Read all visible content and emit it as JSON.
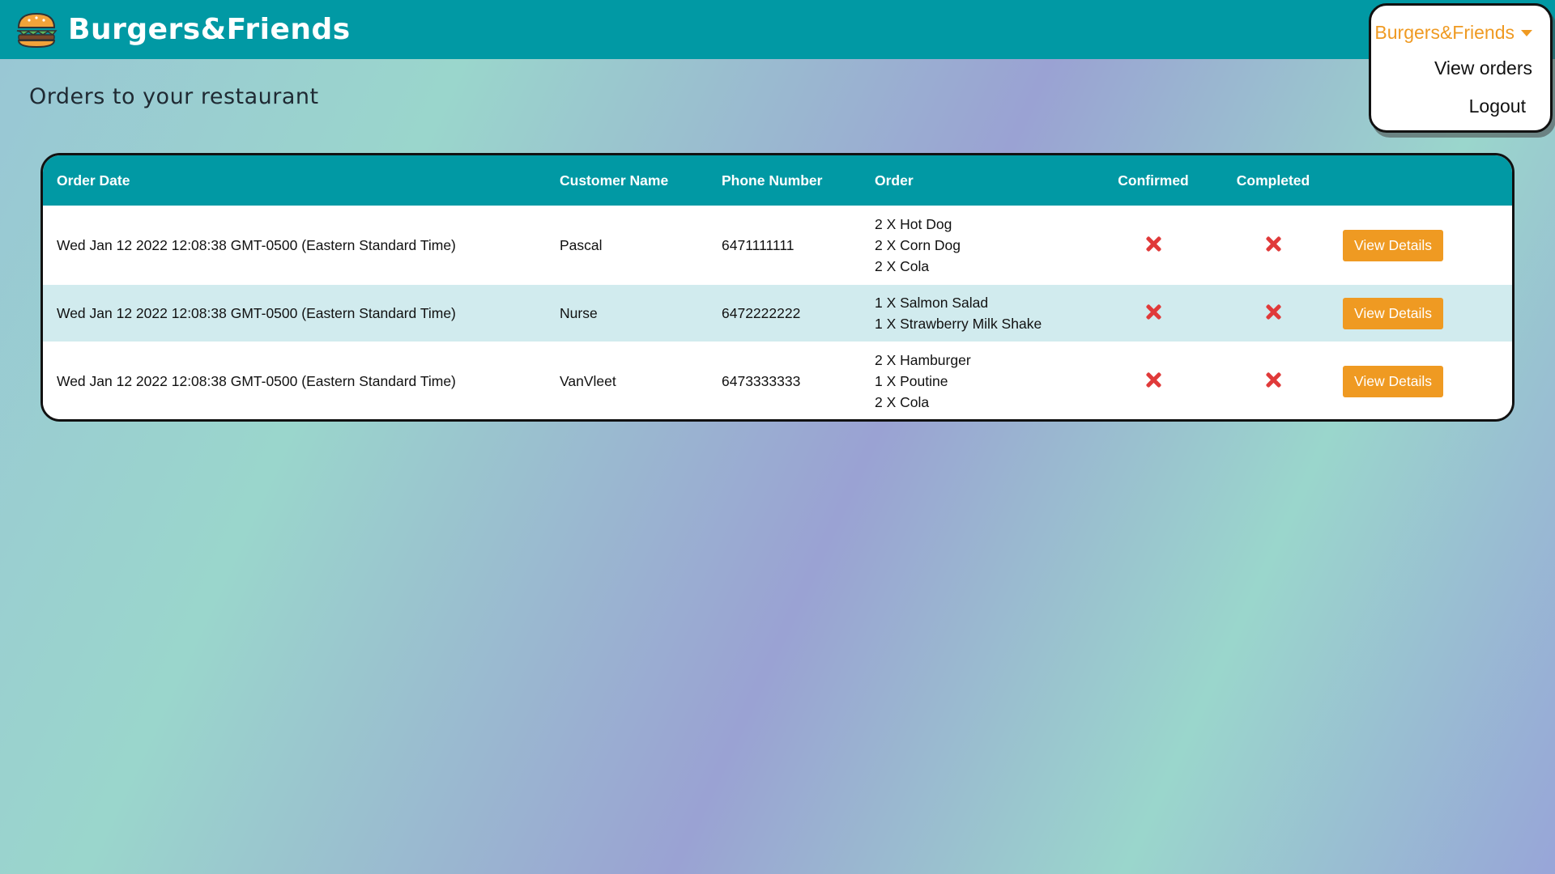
{
  "app": {
    "brand": "Burgers&Friends"
  },
  "page": {
    "title": "Orders to your restaurant"
  },
  "menu": {
    "toggle_label": "Burgers&Friends",
    "items": [
      "View orders",
      "Logout"
    ]
  },
  "table": {
    "headers": [
      "Order Date",
      "Customer Name",
      "Phone Number",
      "Order",
      "Confirmed",
      "Completed"
    ],
    "rows": [
      {
        "date": "Wed Jan 12 2022 12:08:38 GMT-0500 (Eastern Standard Time)",
        "name": "Pascal",
        "phone": "6471111111",
        "order": [
          "2 X Hot Dog",
          "2 X Corn Dog",
          "2 X Cola"
        ],
        "confirmed": false,
        "completed": false,
        "action": "View Details"
      },
      {
        "date": "Wed Jan 12 2022 12:08:38 GMT-0500 (Eastern Standard Time)",
        "name": "Nurse",
        "phone": "6472222222",
        "order": [
          "1 X Salmon Salad",
          "1 X Strawberry Milk Shake"
        ],
        "confirmed": false,
        "completed": false,
        "action": "View Details"
      },
      {
        "date": "Wed Jan 12 2022 12:08:38 GMT-0500 (Eastern Standard Time)",
        "name": "VanVleet",
        "phone": "6473333333",
        "order": [
          "2 X Hamburger",
          "1 X Poutine",
          "2 X Cola"
        ],
        "confirmed": false,
        "completed": false,
        "action": "View Details"
      }
    ]
  },
  "colors": {
    "navbar": "#0199a4",
    "accent": "#ef9a22",
    "status_false": "#e03a3a",
    "alt_row": "#d1ebee"
  },
  "icons": {
    "logo": "burger-icon",
    "status_false": "x-icon",
    "menu_caret": "caret-down-icon"
  }
}
